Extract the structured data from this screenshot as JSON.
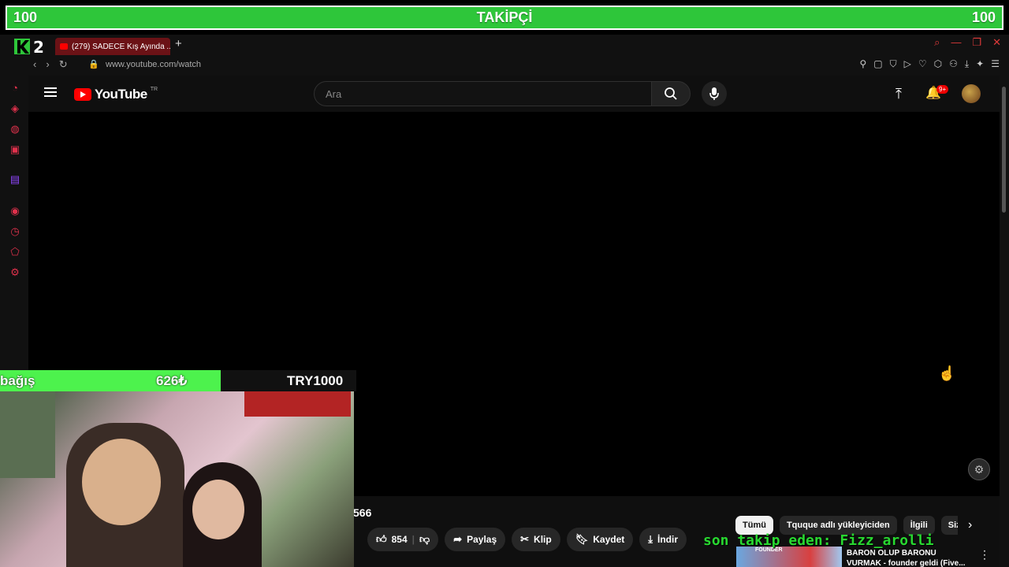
{
  "follower_goal": {
    "current": "100",
    "label": "TAKİPÇİ",
    "target": "100",
    "color": "#2ec63a"
  },
  "browser": {
    "tab_title": "(279) SADECE Kış Ayında ...",
    "url": "www.youtube.com/watch"
  },
  "youtube": {
    "logo_text": "YouTube",
    "region": "TR",
    "search_placeholder": "Ara",
    "notification_badge": "9+"
  },
  "video": {
    "views_fragment": "566",
    "actions": [
      {
        "icon": "like-icon",
        "label": "854"
      },
      {
        "icon": "share-icon",
        "label": "Paylaş"
      },
      {
        "icon": "clip-icon",
        "label": "Klip"
      },
      {
        "icon": "save-icon",
        "label": "Kaydet"
      },
      {
        "icon": "download-icon",
        "label": "İndir"
      }
    ]
  },
  "chips": [
    "Tümü",
    "Tquque adlı yükleyiciden",
    "İlgili",
    "Size"
  ],
  "recommendation": {
    "thumbnail_text": "FOUNDER",
    "title": "BARON OLUP BARONU VURMAK - founder geldi (Five..."
  },
  "donation": {
    "label": "bağış",
    "amount": "626₺",
    "goal": "TRY1000",
    "progress": 0.626,
    "color": "#4df24d"
  },
  "follow_ticker": "son takip eden: Fizz_arolli"
}
